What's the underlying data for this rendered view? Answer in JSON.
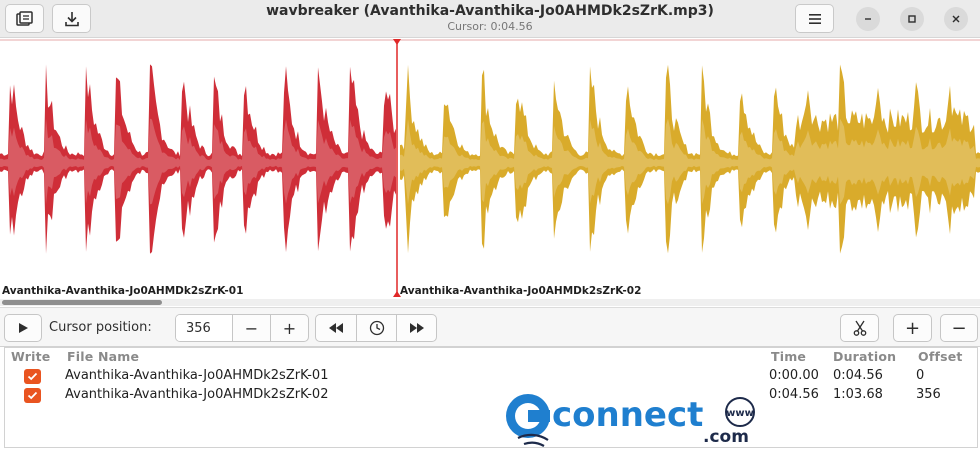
{
  "window": {
    "title": "wavbreaker (Avanthika-Avanthika-Jo0AHMDk2sZrK.mp3)",
    "subtitle": "Cursor: 0:04.56"
  },
  "segments": [
    {
      "label": "Avanthika-Avanthika-Jo0AHMDk2sZrK-01",
      "color": "#cf2e38"
    },
    {
      "label": "Avanthika-Avanthika-Jo0AHMDk2sZrK-02",
      "color": "#d9ab2b"
    }
  ],
  "toolbar": {
    "cursor_label": "Cursor position:",
    "cursor_value": "356",
    "minus": "−",
    "plus": "+"
  },
  "table": {
    "headers": {
      "write": "Write",
      "file_name": "File Name",
      "time": "Time",
      "duration": "Duration",
      "offset": "Offset"
    },
    "rows": [
      {
        "write": true,
        "file_name": "Avanthika-Avanthika-Jo0AHMDk2sZrK-01",
        "time": "0:00.00",
        "duration": "0:04.56",
        "offset": "0"
      },
      {
        "write": true,
        "file_name": "Avanthika-Avanthika-Jo0AHMDk2sZrK-02",
        "time": "0:04.56",
        "duration": "1:03.68",
        "offset": "356"
      }
    ]
  },
  "watermark": {
    "brand": "connect",
    "suffix": ".com",
    "globe_text": "www"
  },
  "colors": {
    "accent": "#e95420",
    "cursor_line": "#e02828"
  }
}
